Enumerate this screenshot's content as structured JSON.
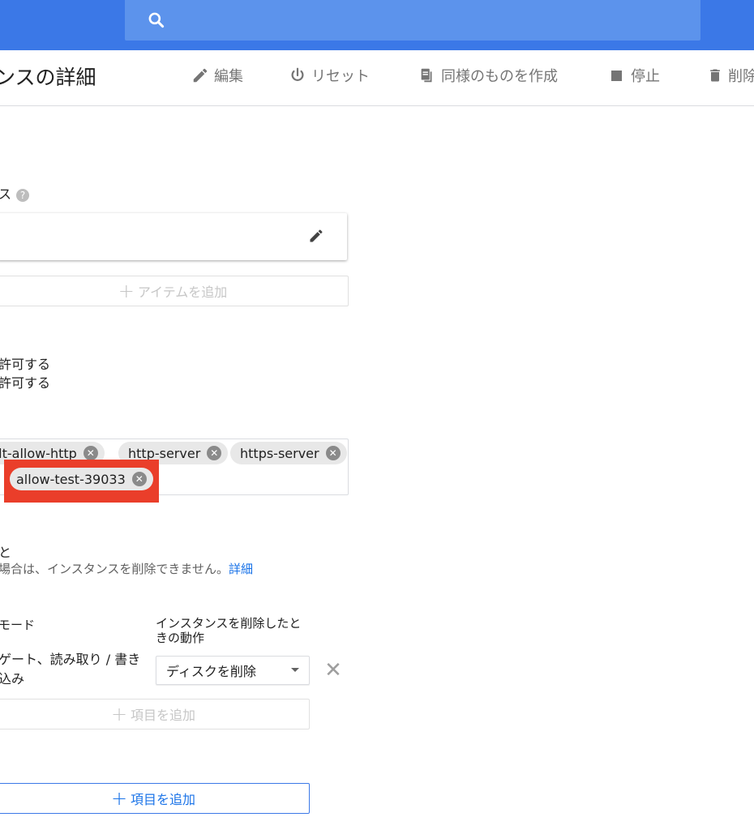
{
  "header": {
    "title": "ンスの詳細",
    "toolbar": {
      "edit": "編集",
      "reset": "リセット",
      "clone": "同様のものを作成",
      "stop": "停止",
      "delete": "削除"
    }
  },
  "network_section": {
    "label": "ス",
    "add_item": "アイテムを追加"
  },
  "firewall": {
    "allow_http": "許可する",
    "allow_https": "許可する"
  },
  "network_tags": {
    "chips": [
      "ult-allow-http",
      "http-server",
      "https-server",
      "allow-test-39033"
    ]
  },
  "deletion_protection": {
    "label": "と",
    "desc": "場合は、インスタンスを削除できません。",
    "link": "詳細"
  },
  "disks": {
    "mode_header": "モード",
    "on_delete_header_line1": "インスタンスを削除したと",
    "on_delete_header_line2": "きの動作",
    "mode_value_line1": "ゲート、読み取り / 書き",
    "mode_value_line2": "込み",
    "on_delete_value": "ディスクを削除",
    "add_item_disabled": "項目を追加",
    "add_item": "項目を追加"
  },
  "colors": {
    "topbar": "#3b78e7",
    "highlight": "#ea3e2a",
    "link": "#1a73e8"
  }
}
